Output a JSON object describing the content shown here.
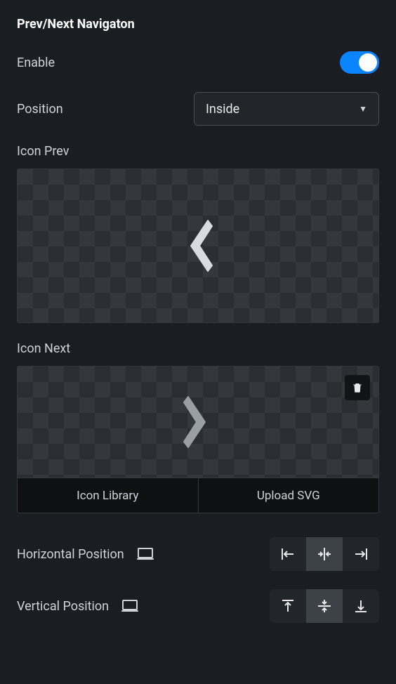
{
  "section_title": "Prev/Next Navigaton",
  "enable": {
    "label": "Enable",
    "value": true
  },
  "position": {
    "label": "Position",
    "value": "Inside"
  },
  "icon_prev": {
    "label": "Icon Prev"
  },
  "icon_next": {
    "label": "Icon Next",
    "actions": {
      "library": "Icon Library",
      "upload": "Upload SVG"
    }
  },
  "horizontal_position": {
    "label": "Horizontal Position",
    "options": [
      "left",
      "center",
      "right"
    ],
    "value": "center"
  },
  "vertical_position": {
    "label": "Vertical Position",
    "options": [
      "top",
      "middle",
      "bottom"
    ],
    "value": "middle"
  }
}
